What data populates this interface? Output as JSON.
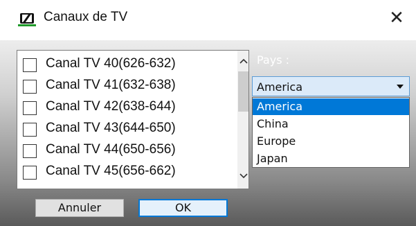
{
  "window": {
    "title": "Canaux de TV",
    "close_glyph": "✕"
  },
  "channels": [
    {
      "label": "Canal TV 40(626-632)",
      "checked": false
    },
    {
      "label": "Canal TV 41(632-638)",
      "checked": false
    },
    {
      "label": "Canal TV 42(638-644)",
      "checked": false
    },
    {
      "label": "Canal TV 43(644-650)",
      "checked": false
    },
    {
      "label": "Canal TV 44(650-656)",
      "checked": false
    },
    {
      "label": "Canal TV 45(656-662)",
      "checked": false
    }
  ],
  "country": {
    "label": "Pays :",
    "selected": "America",
    "options": [
      "America",
      "China",
      "Europe",
      "Japan"
    ]
  },
  "buttons": {
    "cancel": "Annuler",
    "ok": "OK"
  },
  "colors": {
    "selection": "#0078d7",
    "ok_border": "#0078d7",
    "logo_underline": "#1f9a2a"
  },
  "icons": {
    "app": "sennheiser-logo-icon",
    "close": "close-icon",
    "scroll_up": "chevron-up-icon",
    "scroll_down": "chevron-down-icon",
    "dropdown": "caret-down-icon"
  }
}
